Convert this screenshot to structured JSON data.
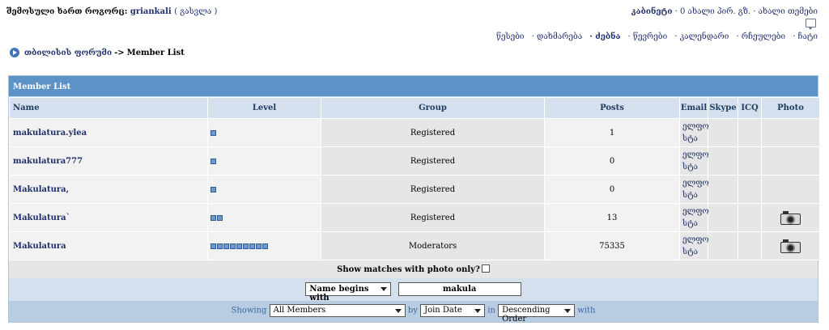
{
  "header": {
    "login_prefix": "შემოსული ხართ როგორც:",
    "username": "griankali",
    "logout_label": "( გასვლა )",
    "cabinet_label": "კაბინეტი",
    "new_pm_label": "· 0 ახალი პირ. გზ.",
    "new_topics_label": "· ახალი თემები"
  },
  "nav": {
    "items": [
      {
        "label": "წესები",
        "selected": false
      },
      {
        "label": "· დახმარება",
        "selected": false
      },
      {
        "label": "· ძებნა",
        "selected": true
      },
      {
        "label": "· წევრები",
        "selected": false
      },
      {
        "label": "· კალენდარი",
        "selected": false
      },
      {
        "label": "· რჩეულები",
        "selected": false
      },
      {
        "label": "· ჩატი",
        "selected": false
      }
    ]
  },
  "breadcrumb": {
    "forum": "თბილისის ფორუმი",
    "separator": "->",
    "current": "Member List"
  },
  "board": {
    "title": "Member List",
    "columns": [
      "Name",
      "Level",
      "Group",
      "Posts",
      "Email",
      "Skype",
      "ICQ",
      "Photo"
    ],
    "members": [
      {
        "name": "makulatura.ylea",
        "level": 1,
        "group": "Registered",
        "posts": "1",
        "email": "ელფო სტა",
        "photo": false
      },
      {
        "name": "makulatura777",
        "level": 1,
        "group": "Registered",
        "posts": "0",
        "email": "ელფო სტა",
        "photo": false
      },
      {
        "name": "Makulatura,",
        "level": 1,
        "group": "Registered",
        "posts": "0",
        "email": "ელფო სტა",
        "photo": false
      },
      {
        "name": "Makulatura`",
        "level": 2,
        "group": "Registered",
        "posts": "13",
        "email": "ელფო სტა",
        "photo": true
      },
      {
        "name": "Makulatura",
        "level": 9,
        "group": "Moderators",
        "posts": "75335",
        "email": "ელფო სტა",
        "photo": true
      }
    ],
    "photo_filter_label": "Show matches with photo only?",
    "search": {
      "mode": "Name begins with",
      "value": "makula"
    },
    "sort": {
      "showing_label": "Showing",
      "filter": "All Members",
      "by_label": "by",
      "order_field": "Join Date",
      "in_label": "in",
      "direction": "Descending Order",
      "with_label": "with"
    }
  },
  "colors": {
    "header_blue": "#5d92c6",
    "column_header": "#d4e0ed",
    "link": "#1f2e6b"
  }
}
